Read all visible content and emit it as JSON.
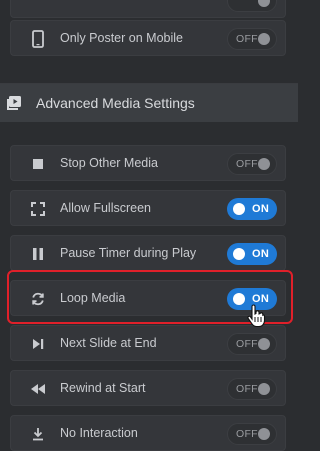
{
  "rows": {
    "only_poster": {
      "label": "Only Poster on Mobile",
      "toggle": "OFF"
    },
    "stop_other": {
      "label": "Stop Other Media",
      "toggle": "OFF"
    },
    "allow_fullscreen": {
      "label": "Allow Fullscreen",
      "toggle": "ON"
    },
    "pause_timer": {
      "label": "Pause Timer during Play",
      "toggle": "ON"
    },
    "loop_media": {
      "label": "Loop Media",
      "toggle": "ON"
    },
    "next_slide": {
      "label": "Next Slide at End",
      "toggle": "OFF"
    },
    "rewind": {
      "label": "Rewind at Start",
      "toggle": "OFF"
    },
    "no_interaction": {
      "label": "No Interaction",
      "toggle": "OFF"
    }
  },
  "section": {
    "title": "Advanced Media Settings"
  },
  "colors": {
    "accent": "#1f7ad6",
    "highlight": "#e0202a",
    "background": "#2b2d30"
  }
}
